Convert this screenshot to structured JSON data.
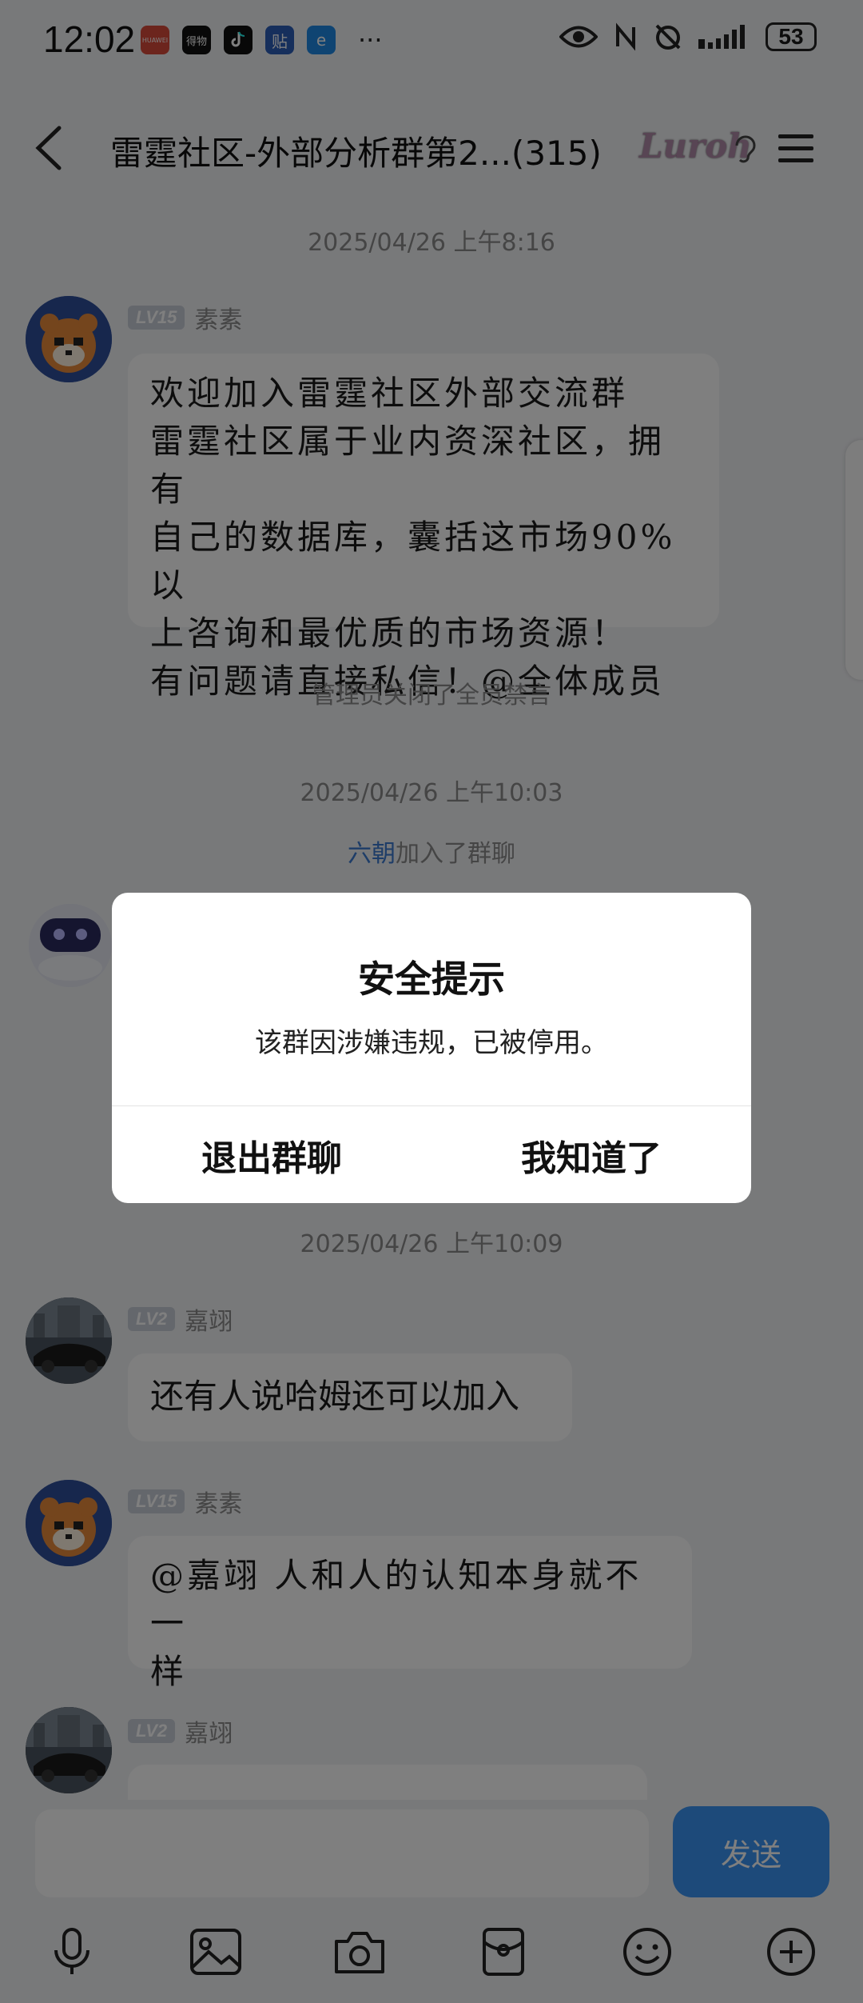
{
  "status_bar": {
    "time": "12:02",
    "apps": [
      "HUAWEI",
      "得物",
      "TikTok",
      "贴",
      "e"
    ],
    "more": "···",
    "battery": "53"
  },
  "header": {
    "title": "雷霆社区-外部分析群第2...(315)",
    "badge": "Luroh"
  },
  "messages": {
    "ts1": "2025/04/26 上午8:16",
    "msg1": {
      "level": "LV15",
      "sender": "素素",
      "text": "欢迎加入雷霆社区外部交流群\n雷霆社区属于业内资深社区，拥有\n自己的数据库，囊括这市场90%以\n上咨询和最优质的市场资源！\n有问题请直接私信！@全体成员"
    },
    "sys1": "管理员关闭了全员禁言",
    "ts2": "2025/04/26 上午10:03",
    "join_name": "六朝",
    "join_text": "加入了群聊",
    "ts3": "2025/04/26 上午10:09",
    "msg2": {
      "level": "LV2",
      "sender": "嘉翊",
      "text": "还有人说哈姆还可以加入"
    },
    "msg3": {
      "level": "LV15",
      "sender": "素素",
      "text": "@嘉翊 人和人的认知本身就不一\n样"
    },
    "msg4": {
      "level": "LV2",
      "sender": "嘉翊"
    }
  },
  "input": {
    "send_label": "发送"
  },
  "dialog": {
    "title": "安全提示",
    "body": "该群因涉嫌违规，已被停用。",
    "exit_label": "退出群聊",
    "ok_label": "我知道了"
  },
  "colors": {
    "accent": "#3b95f5",
    "link": "#3d7bd0",
    "background": "#f1f2f5"
  }
}
